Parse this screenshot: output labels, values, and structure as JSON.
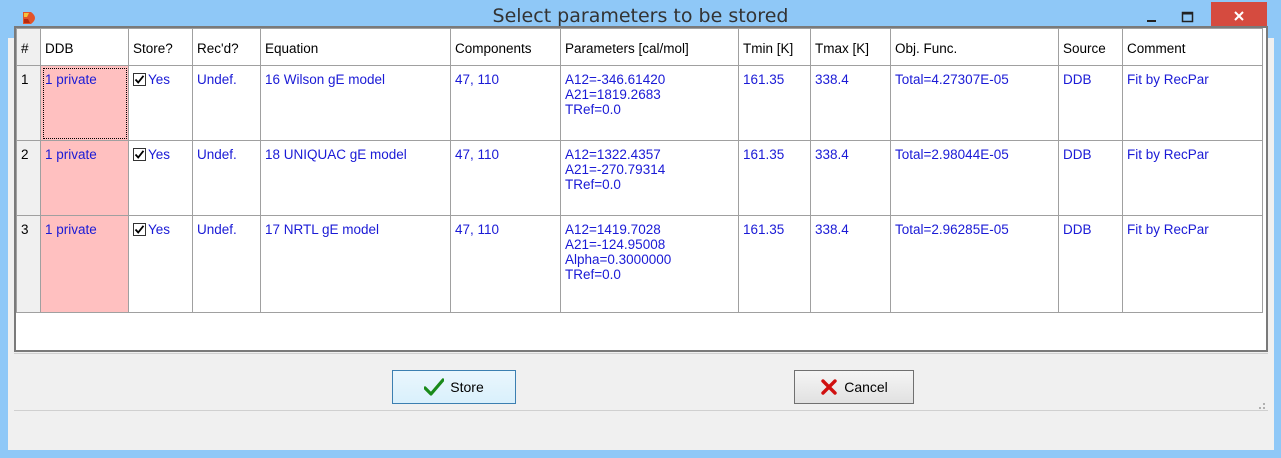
{
  "window": {
    "title": "Select parameters to be stored",
    "app_icon": "ddb-app-icon",
    "controls": [
      "minimize-icon",
      "maximize-icon",
      "close-icon"
    ]
  },
  "table": {
    "headers": [
      "#",
      "DDB",
      "Store?",
      "Rec'd?",
      "Equation",
      "Components",
      "Parameters [cal/mol]",
      "Tmin [K]",
      "Tmax [K]",
      "Obj. Func.",
      "Source",
      "Comment"
    ],
    "rows": [
      {
        "num": "1",
        "ddb": "1 private",
        "store": "Yes",
        "store_checked": true,
        "recd": "Undef.",
        "equation": "16 Wilson gE model",
        "components": "47, 110",
        "parameters": [
          "A12=-346.61420",
          "A21=1819.2683",
          "TRef=0.0"
        ],
        "tmin": "161.35",
        "tmax": "338.4",
        "objfunc": "Total=4.27307E-05",
        "source": "DDB",
        "comment": "Fit by RecPar"
      },
      {
        "num": "2",
        "ddb": "1 private",
        "store": "Yes",
        "store_checked": true,
        "recd": "Undef.",
        "equation": "18 UNIQUAC gE model",
        "components": "47, 110",
        "parameters": [
          "A12=1322.4357",
          "A21=-270.79314",
          "TRef=0.0"
        ],
        "tmin": "161.35",
        "tmax": "338.4",
        "objfunc": "Total=2.98044E-05",
        "source": "DDB",
        "comment": "Fit by RecPar"
      },
      {
        "num": "3",
        "ddb": "1 private",
        "store": "Yes",
        "store_checked": true,
        "recd": "Undef.",
        "equation": "17 NRTL gE model",
        "components": "47, 110",
        "parameters": [
          "A12=1419.7028",
          "A21=-124.95008",
          "Alpha=0.3000000",
          "TRef=0.0"
        ],
        "tmin": "161.35",
        "tmax": "338.4",
        "objfunc": "Total=2.96285E-05",
        "source": "DDB",
        "comment": "Fit by RecPar"
      }
    ]
  },
  "buttons": {
    "store_label": "Store",
    "cancel_label": "Cancel"
  },
  "colors": {
    "title_bar": "#8fc8f7",
    "close_button": "#d54b3f",
    "ddb_cell": "#ffc0c0",
    "cell_text": "#1a1ad6",
    "store_check": "#1a8a1a",
    "cancel_x": "#d01010"
  }
}
